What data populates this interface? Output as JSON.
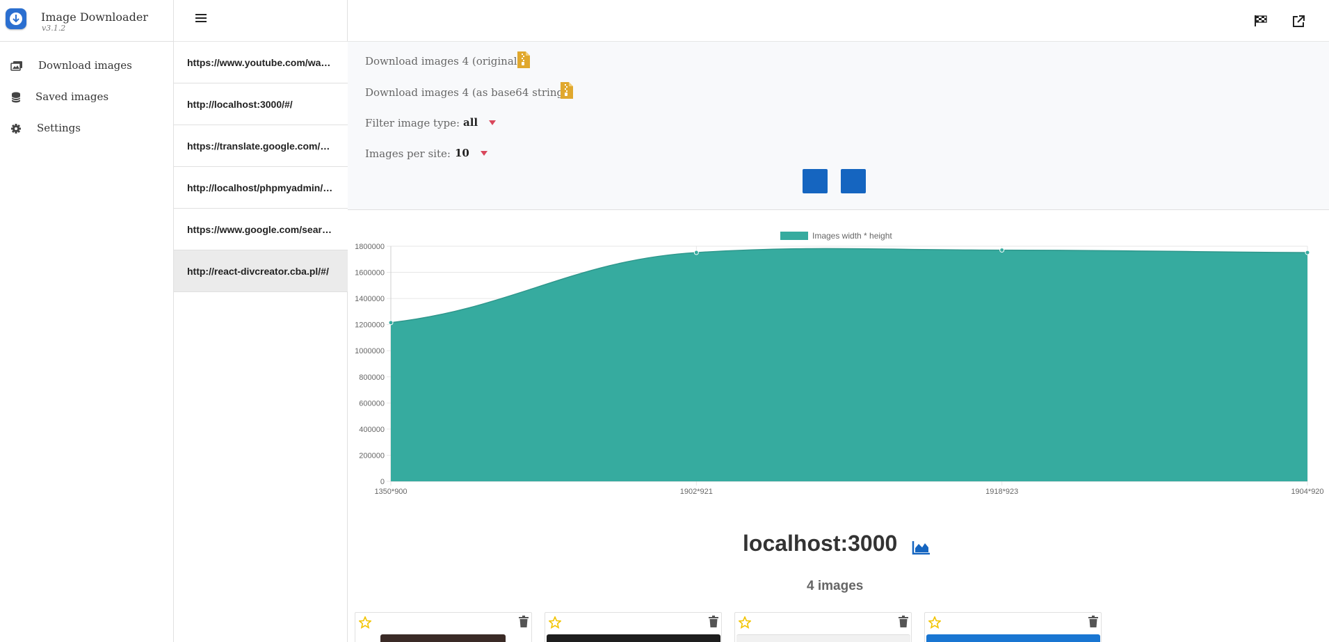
{
  "app": {
    "title": "Image Downloader",
    "version": "v3.1.2"
  },
  "sidebar": {
    "items": [
      {
        "label": "Download images",
        "icon": "images-icon"
      },
      {
        "label": "Saved images",
        "icon": "database-icon"
      },
      {
        "label": "Settings",
        "icon": "gear-icon"
      }
    ]
  },
  "urls": [
    {
      "label": "https://www.youtube.com/watch?v=",
      "active": false
    },
    {
      "label": "http://localhost:3000/#/",
      "active": false
    },
    {
      "label": "https://translate.google.com/?hl=",
      "active": false
    },
    {
      "label": "http://localhost/phpmyadmin/tbl_",
      "active": false
    },
    {
      "label": "https://www.google.com/search?q=",
      "active": false
    },
    {
      "label": "http://react-divcreator.cba.pl/#/",
      "active": true
    }
  ],
  "controls": {
    "download_original": "Download images 4 (original)",
    "download_base64": "Download images 4 (as base64 string)",
    "filter_label": "Filter image type:",
    "filter_value": "all",
    "per_site_label": "Images per site:",
    "per_site_value": "10"
  },
  "colors": {
    "accent": "#1565c0",
    "chart_fill": "#36ab9f",
    "zip": "#e0a82e",
    "caret": "#d9475b",
    "star": "#f2c400"
  },
  "chart_data": {
    "type": "area",
    "legend": "Images width * height",
    "categories": [
      "1350*900",
      "1902*921",
      "1918*923",
      "1904*920"
    ],
    "values": [
      1215000,
      1751742,
      1770314,
      1751680
    ],
    "ylim": [
      0,
      1800000
    ],
    "yticks": [
      "0",
      "200000",
      "400000",
      "600000",
      "800000",
      "1000000",
      "1200000",
      "1400000",
      "1600000",
      "1800000"
    ],
    "grid": true,
    "legend_position": "top"
  },
  "site": {
    "title": "localhost:3000",
    "count_label": "4 images"
  },
  "cards": [
    {
      "thumb_color": "#3a2a26"
    },
    {
      "thumb_color": "#1e1e1e"
    },
    {
      "thumb_color": "#f1f1f1"
    },
    {
      "thumb_color": "#1976d2"
    }
  ]
}
